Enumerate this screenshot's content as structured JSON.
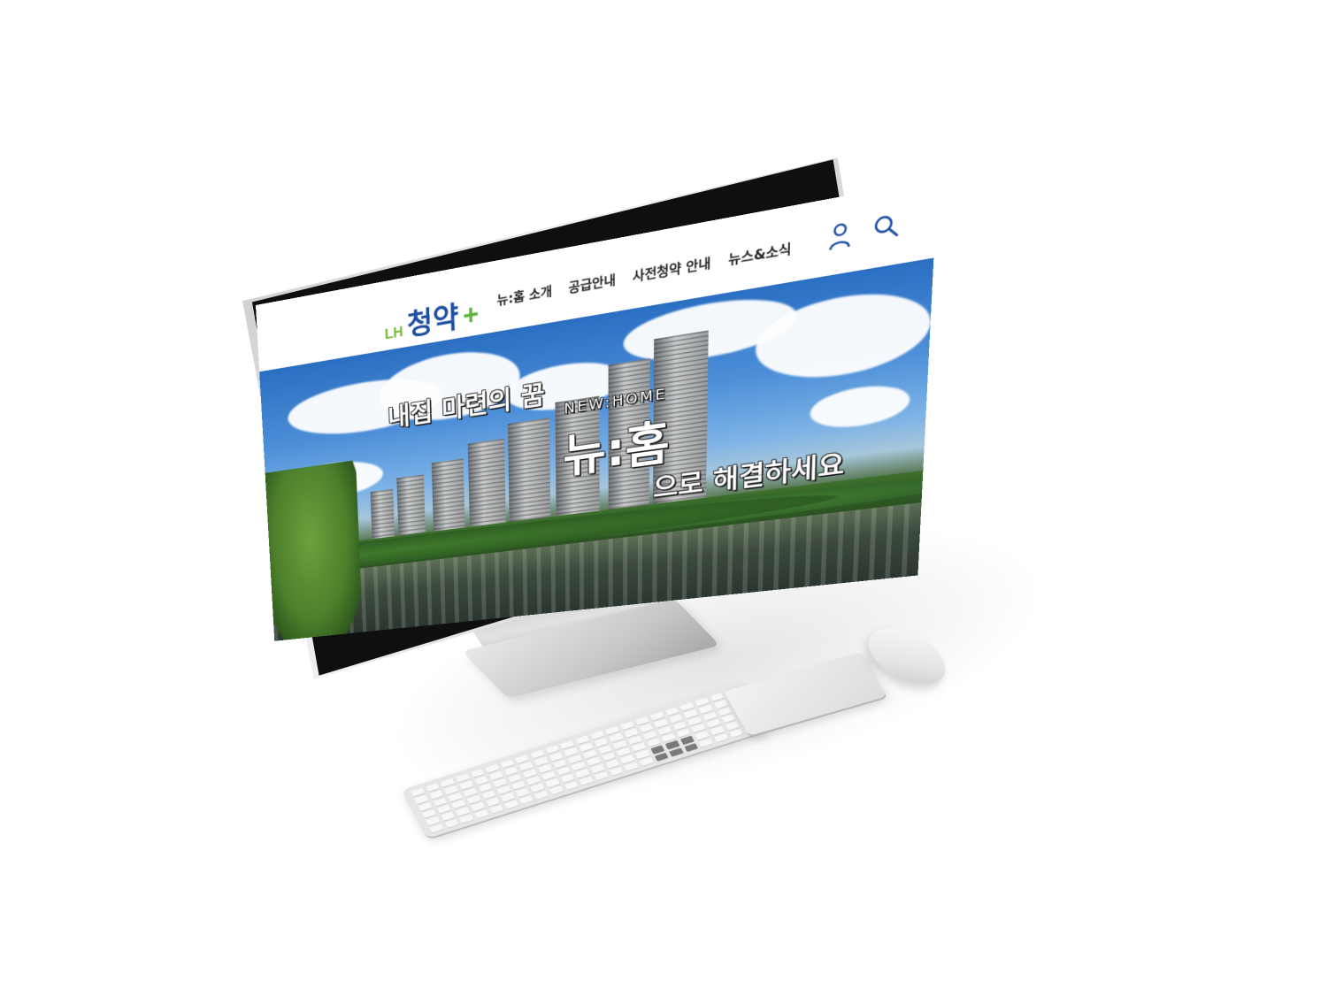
{
  "site": {
    "logo": {
      "prefix": "LH",
      "name": "청약",
      "plus": "+"
    },
    "nav": [
      {
        "label": "뉴:홈 소개"
      },
      {
        "label": "공급안내"
      },
      {
        "label": "사전청약 안내"
      },
      {
        "label": "뉴스&소식"
      }
    ],
    "icons": {
      "user": "user-icon",
      "search": "search-icon"
    },
    "hero": {
      "line1": "내집 마련의 꿈",
      "sub": "NEW:HOME",
      "brand": "뉴:홈",
      "line2": "으로 해결하세요"
    }
  },
  "colors": {
    "logo_prefix": "#7ab83a",
    "logo_main": "#1e4fa3",
    "logo_plus": "#5fb53b",
    "icon": "#1e4fa3"
  }
}
